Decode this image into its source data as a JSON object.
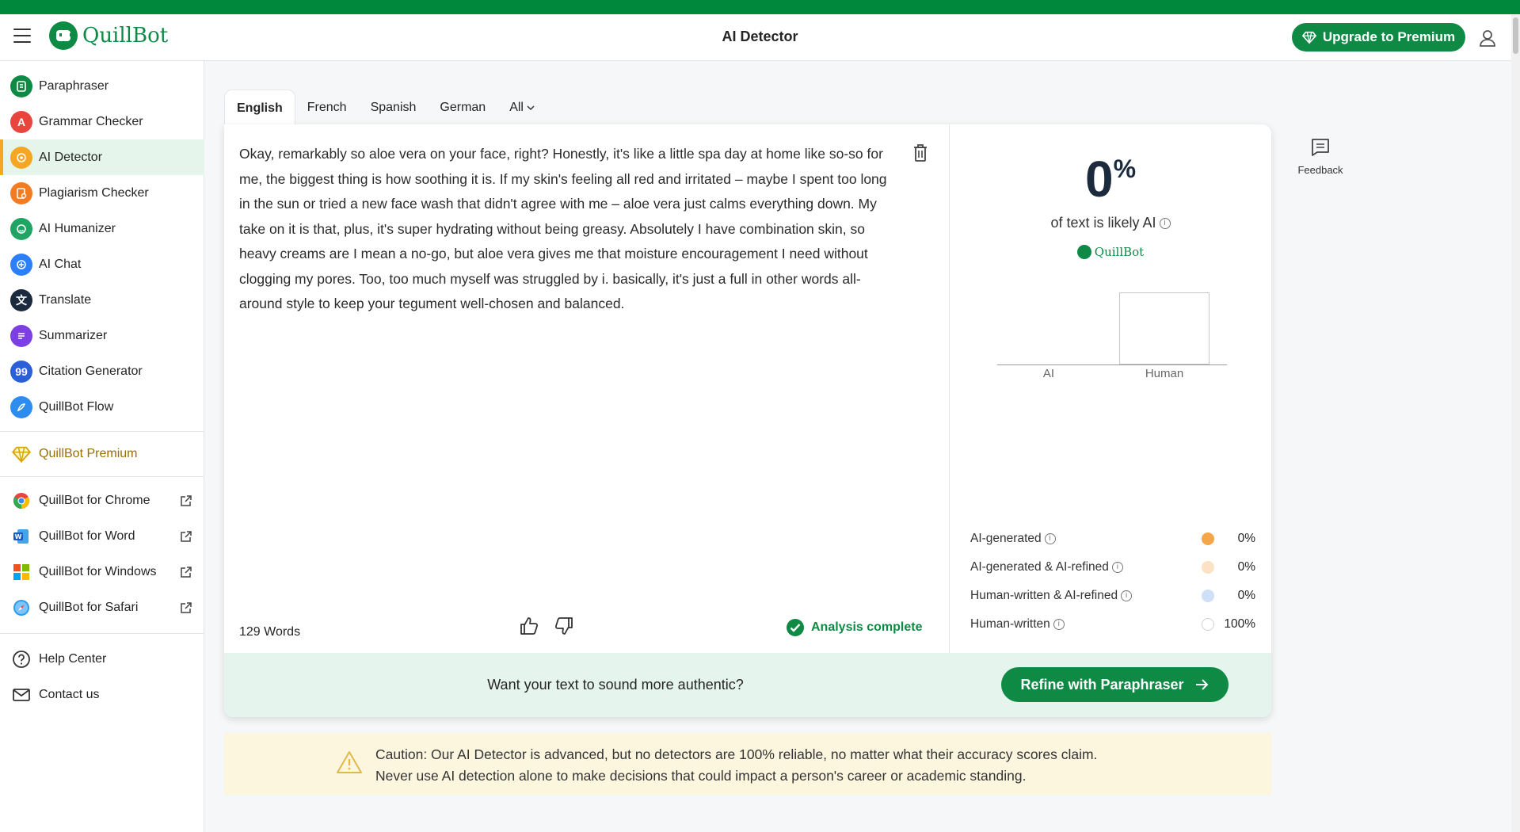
{
  "header": {
    "logo_text": "QuillBot",
    "title": "AI Detector",
    "upgrade_label": "Upgrade to Premium"
  },
  "sidebar": {
    "tools": [
      {
        "label": "Paraphraser",
        "icon": "paraphraser-icon",
        "color": "#0e8a45"
      },
      {
        "label": "Grammar Checker",
        "icon": "grammar-icon",
        "color": "#e8453c"
      },
      {
        "label": "AI Detector",
        "icon": "ai-detector-icon",
        "color": "#f5a623",
        "active": true
      },
      {
        "label": "Plagiarism Checker",
        "icon": "plagiarism-icon",
        "color": "#f37c22"
      },
      {
        "label": "AI Humanizer",
        "icon": "humanizer-icon",
        "color": "#1fa463"
      },
      {
        "label": "AI Chat",
        "icon": "chat-icon",
        "color": "#2d7ff9"
      },
      {
        "label": "Translate",
        "icon": "translate-icon",
        "color": "#1c2a3e"
      },
      {
        "label": "Summarizer",
        "icon": "summarizer-icon",
        "color": "#7b3fe4"
      },
      {
        "label": "Citation Generator",
        "icon": "citation-icon",
        "color": "#2b5fd9"
      },
      {
        "label": "QuillBot Flow",
        "icon": "flow-icon",
        "color": "#2d8cf0"
      }
    ],
    "premium_label": "QuillBot Premium",
    "extensions": [
      {
        "label": "QuillBot for Chrome",
        "icon": "chrome-icon"
      },
      {
        "label": "QuillBot for Word",
        "icon": "word-icon"
      },
      {
        "label": "QuillBot for Windows",
        "icon": "windows-icon"
      },
      {
        "label": "QuillBot for Safari",
        "icon": "safari-icon"
      }
    ],
    "support": [
      {
        "label": "Help Center",
        "icon": "help-icon"
      },
      {
        "label": "Contact us",
        "icon": "mail-icon"
      }
    ]
  },
  "languages": {
    "tabs": [
      "English",
      "French",
      "Spanish",
      "German",
      "All"
    ],
    "active": "English"
  },
  "editor": {
    "text": "Okay, remarkably so aloe vera on your face, right? Honestly, it's like a little spa day at home like so-so for me, the biggest thing is how soothing it is. If my skin's feeling all red and irritated – maybe I spent too long in the sun or tried a new face wash that didn't agree with me – aloe vera just calms everything down. My take on it is that, plus, it's super hydrating without being greasy. Absolutely I have combination skin, so heavy creams are I mean a no-go, but aloe vera gives me that moisture encouragement I need without clogging my pores. Too, too much myself was struggled by i. basically, it's just a full in other words all-around style to keep your tegument well-chosen and balanced.",
    "word_count": "129 Words",
    "status": "Analysis complete"
  },
  "results": {
    "score": "0",
    "score_unit": "%",
    "likely_text": "of text is likely AI",
    "brand": "QuillBot",
    "legend": [
      {
        "label": "AI-generated",
        "value": "0%",
        "color": "#f5a54a"
      },
      {
        "label": "AI-generated & AI-refined",
        "value": "0%",
        "color": "#fbe2c4"
      },
      {
        "label": "Human-written & AI-refined",
        "value": "0%",
        "color": "#cfe0f8"
      },
      {
        "label": "Human-written",
        "value": "100%",
        "color": "#ffffff"
      }
    ]
  },
  "chart_data": {
    "type": "bar",
    "categories": [
      "AI",
      "Human"
    ],
    "values": [
      0,
      100
    ],
    "ylim": [
      0,
      100
    ],
    "grid": false
  },
  "cta": {
    "text": "Want your text to sound more authentic?",
    "button_label": "Refine with Paraphraser"
  },
  "caution": {
    "line1": "Caution: Our AI Detector is advanced, but no detectors are 100% reliable, no matter what their accuracy scores claim.",
    "line2": "Never use AI detection alone to make decisions that could impact a person's career or academic standing."
  },
  "feedback": {
    "label": "Feedback"
  },
  "colors": {
    "brand": "#0e8a45",
    "top_strip": "#00883c",
    "active_nav": "#e6f5ec",
    "cta_band": "#e5f5ee",
    "caution_bg": "#fdf6df"
  }
}
